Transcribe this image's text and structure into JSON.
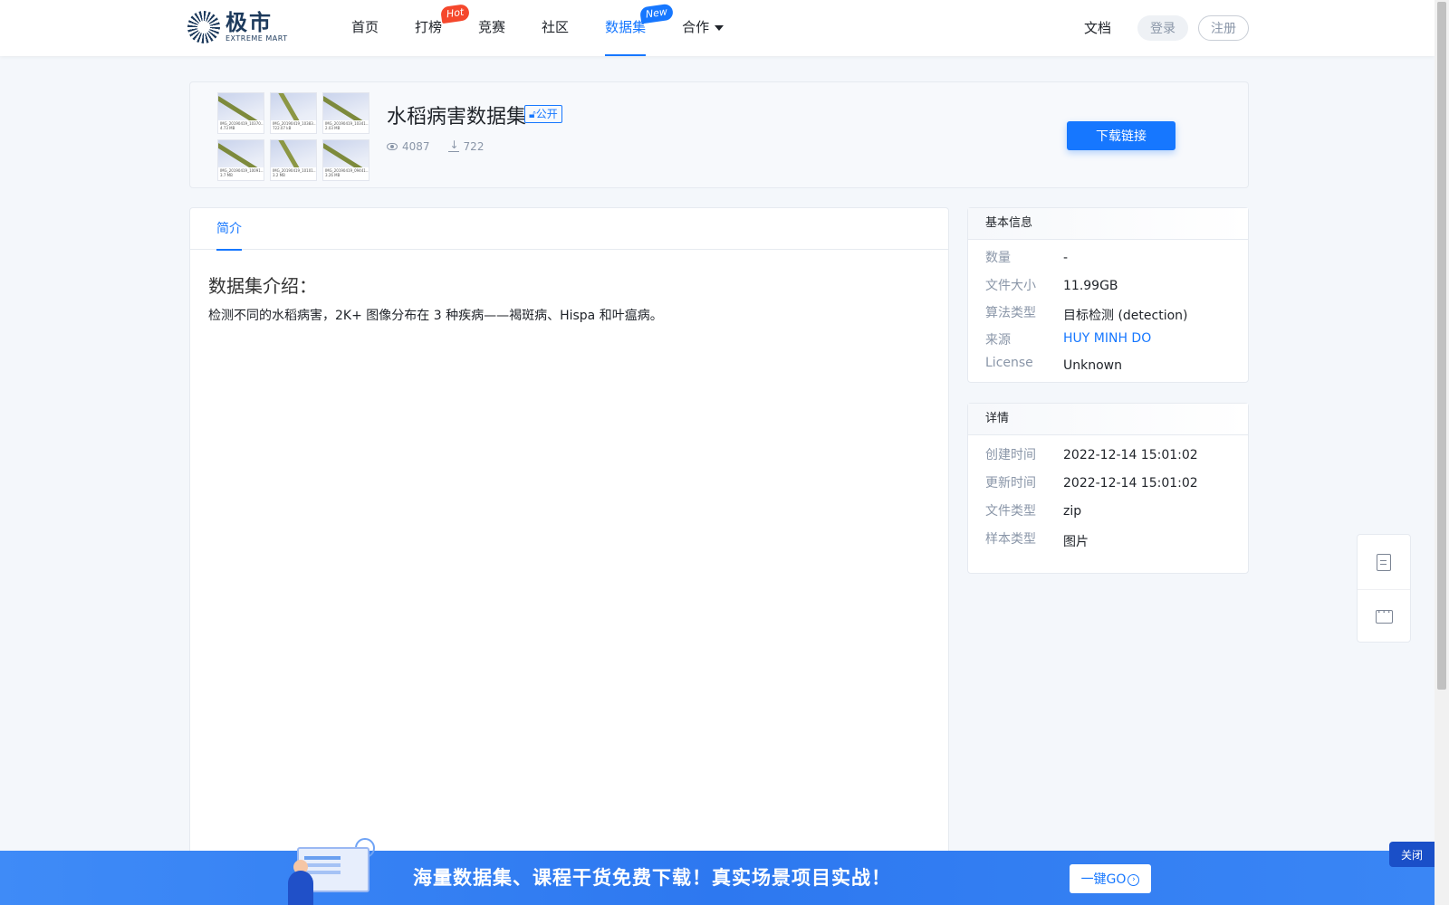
{
  "brand": {
    "name_cn": "极市",
    "name_en": "EXTREME MART"
  },
  "nav": {
    "items": [
      {
        "label": "首页",
        "badge": ""
      },
      {
        "label": "打榜",
        "badge": "Hot"
      },
      {
        "label": "竞赛",
        "badge": ""
      },
      {
        "label": "社区",
        "badge": ""
      },
      {
        "label": "数据集",
        "badge": "New",
        "active": true
      },
      {
        "label": "合作",
        "badge": "",
        "dropdown": true
      }
    ],
    "docs": "文档",
    "login": "登录",
    "register": "注册"
  },
  "dataset": {
    "title": "水稻病害数据集",
    "visibility": "公开",
    "views": "4087",
    "downloads": "722",
    "download_button": "下载链接",
    "thumbnails": [
      {
        "name": "IMG_20190419_10370...",
        "size": "4.73 MB"
      },
      {
        "name": "IMG_20190419_10383...",
        "size": "722.07 kB"
      },
      {
        "name": "IMG_20190419_10341...",
        "size": "2.03 MB"
      },
      {
        "name": "IMG_20190419_10091...",
        "size": "3.7 MB"
      },
      {
        "name": "IMG_20190419_10101...",
        "size": "3.2 MB"
      },
      {
        "name": "IMG_20190419_09441...",
        "size": "3.26 MB"
      }
    ]
  },
  "tabs": {
    "intro": "简介"
  },
  "intro": {
    "heading": "数据集介绍：",
    "text": "检测不同的水稻病害，2K+ 图像分布在 3 种疾病——褐斑病、Hispa 和叶瘟病。"
  },
  "basic_info": {
    "title": "基本信息",
    "rows": [
      {
        "label": "数量",
        "value": "-"
      },
      {
        "label": "文件大小",
        "value": "11.99GB"
      },
      {
        "label": "算法类型",
        "value": "目标检测 (detection)"
      },
      {
        "label": "来源",
        "value": "HUY MINH DO"
      },
      {
        "label": "License",
        "value": "Unknown"
      }
    ]
  },
  "details": {
    "title": "详情",
    "rows": [
      {
        "label": "创建时间",
        "value": "2022-12-14 15:01:02"
      },
      {
        "label": "更新时间",
        "value": "2022-12-14 15:01:02"
      },
      {
        "label": "文件类型",
        "value": "zip"
      },
      {
        "label": "样本类型",
        "value": "图片"
      }
    ]
  },
  "banner": {
    "text": "海量数据集、课程干货免费下载！真实场景项目实战！",
    "go_button": "一键GO",
    "close": "关闭"
  },
  "colors": {
    "accent": "#1677ff",
    "hot": "#f5472c",
    "banner": "#2d78f0"
  },
  "icons": [
    "eye-icon",
    "download-icon",
    "note-icon",
    "chat-icon",
    "lock-icon",
    "chevron-down-icon"
  ]
}
